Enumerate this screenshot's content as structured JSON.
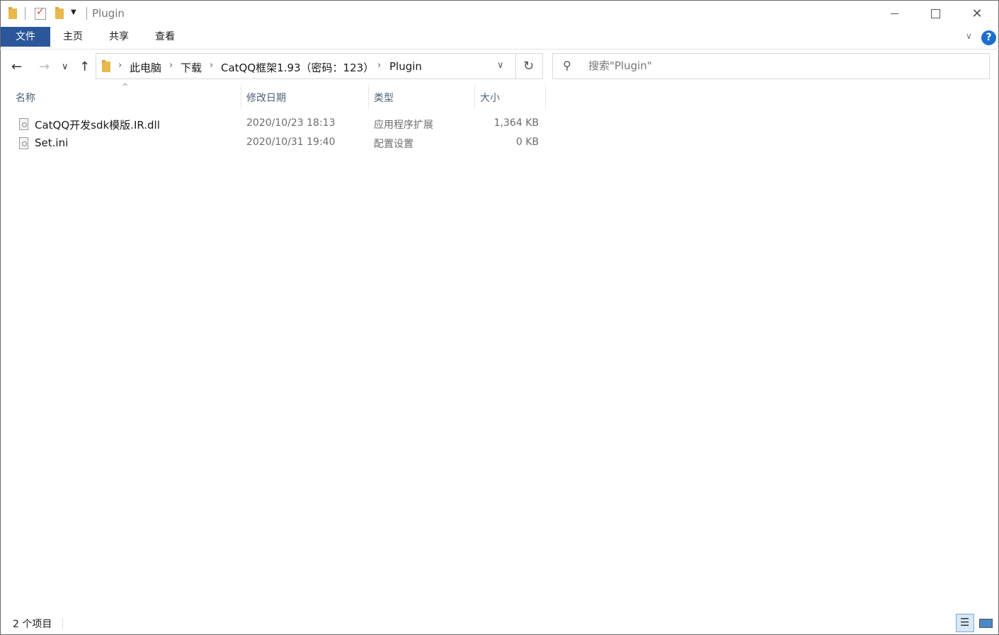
{
  "window": {
    "title": "Plugin"
  },
  "ribbon": {
    "tabs": [
      "文件",
      "主页",
      "共享",
      "查看"
    ]
  },
  "nav": {
    "breadcrumbs": [
      "此电脑",
      "下载",
      "CatQQ框架1.93（密码：123）",
      "Plugin"
    ],
    "search_placeholder": "搜索\"Plugin\""
  },
  "columns": {
    "name": "名称",
    "date": "修改日期",
    "type": "类型",
    "size": "大小"
  },
  "files": [
    {
      "name": "CatQQ开发sdk模版.IR.dll",
      "date": "2020/10/23 18:13",
      "type": "应用程序扩展",
      "size": "1,364 KB",
      "icon": "dll-file-icon"
    },
    {
      "name": "Set.ini",
      "date": "2020/10/31 19:40",
      "type": "配置设置",
      "size": "0 KB",
      "icon": "ini-file-icon"
    }
  ],
  "status": {
    "item_count": "2 个项目"
  },
  "colors": {
    "file_tab": "#2b579a",
    "help": "#1c6fd0"
  }
}
